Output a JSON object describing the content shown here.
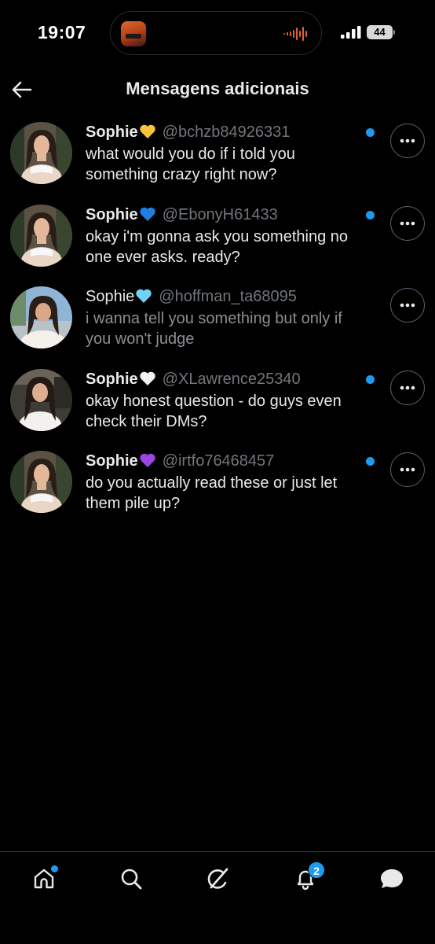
{
  "status_bar": {
    "time": "19:07",
    "battery": "44",
    "live_activity_icon": "app-icon",
    "waveform_color": "#e0642f"
  },
  "header": {
    "title": "Mensagens adicionais",
    "back_icon": "arrow-left-icon"
  },
  "colors": {
    "accent": "#1d9bf0",
    "handle": "#71767b",
    "background": "#000000"
  },
  "messages": [
    {
      "name": "Sophie",
      "heart": "yellow-heart",
      "heart_color": "#f9c23c",
      "handle": "@bchzb84926331",
      "text": "what would you do if i told you something crazy right now?",
      "unread": true
    },
    {
      "name": "Sophie",
      "heart": "blue-heart",
      "heart_color": "#1f7fe0",
      "handle": "@EbonyH61433",
      "text": "okay i'm gonna ask you something no one ever asks. ready?",
      "unread": true
    },
    {
      "name": "Sophie",
      "heart": "light-blue-heart",
      "heart_color": "#6fd3f5",
      "handle": "@hoffman_ta68095",
      "text": "i wanna tell you something but only if you won't judge",
      "unread": false
    },
    {
      "name": "Sophie",
      "heart": "white-heart",
      "heart_color": "#f2f2f2",
      "handle": "@XLawrence25340",
      "text": "okay honest question - do guys even check their DMs?",
      "unread": true
    },
    {
      "name": "Sophie",
      "heart": "purple-heart",
      "heart_color": "#9b45e4",
      "handle": "@irtfo76468457",
      "text": "do you actually read these or just let them pile up?",
      "unread": true
    }
  ],
  "bottom_nav": {
    "items": [
      {
        "name": "home-icon",
        "badge_dot": true
      },
      {
        "name": "search-icon"
      },
      {
        "name": "grok-icon"
      },
      {
        "name": "bell-icon",
        "badge_count": "2"
      },
      {
        "name": "messages-icon"
      }
    ]
  }
}
